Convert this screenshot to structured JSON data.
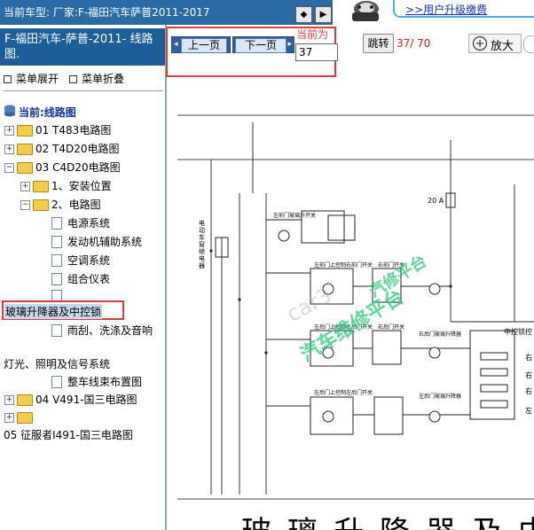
{
  "top_bar": {
    "title": "当前车型:  厂家:F-福田汽车萨普2011-2017",
    "upgrade_link": ">>用户升级缴费"
  },
  "sidebar": {
    "car_title": "F-福田汽车-萨普-2011- 线路图.",
    "expand_all": "菜单展开",
    "collapse_all": "菜单折叠",
    "current_label": "当前:线路图",
    "tree": {
      "n01": "01 T483电路图",
      "n02": "02 T4D20电路图",
      "n03": "03 C4D20电路图",
      "n03_1": "1、安装位置",
      "n03_2": "2、电路图",
      "leaf1": "电源系统",
      "leaf2": "发动机辅助系统",
      "leaf3": "空调系统",
      "leaf4": "组合仪表",
      "leaf_selected": "玻璃升降器及中控锁",
      "leaf6": "雨刮、洗涤及音响",
      "leaf7": "灯光、照明及信号系统",
      "leaf8": "整车线束布置图",
      "n04": "04 V491-国三电路图",
      "n05": "05 征服者I491-国三电路图"
    }
  },
  "toolbar": {
    "prev": "上一页",
    "next": "下一页",
    "current_page_label": "当前为",
    "current_page_value": "37",
    "jump": "跳转",
    "page_count": "37/ 70",
    "zoom": "放大"
  },
  "diagram": {
    "fuse_label": "20 A",
    "part_label": "中控锁控",
    "sw1": "左前门玻璃升开关",
    "sw2": "左前门上控制右前门开关",
    "sw3": "右前门开关",
    "sw4": "左后门上控制右后门开关",
    "sw5": "右后门开关",
    "sw6": "右后门玻璃升降器",
    "sw7": "左后门上控制左后门开关",
    "sw8": "左后门玻璃升降器",
    "vert_label": "电动车窗继电器",
    "right_labels": [
      "右",
      "右",
      "右",
      "左"
    ],
    "watermark1": "car3",
    "watermark2": "汽修平台",
    "watermark3": "汽车维修平台",
    "big_title": "玻璃升降器及中控锁"
  }
}
